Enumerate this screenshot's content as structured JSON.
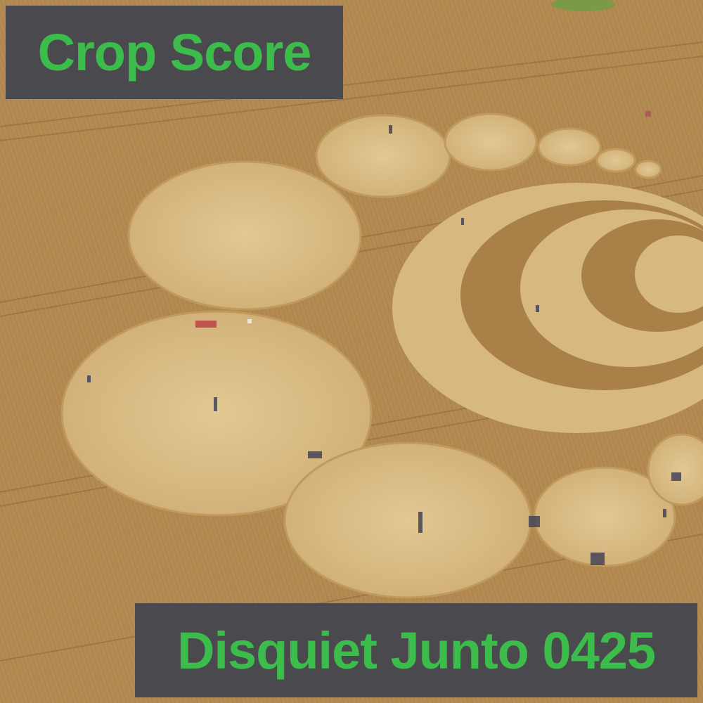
{
  "image": {
    "subject": "aerial-photo-crop-circles",
    "colors": {
      "field": "#b28a52",
      "field_dark": "#9e7640",
      "circle_fill": "#d8bb84",
      "circle_edge": "#c9a86c",
      "label_bg": "#4a4a4e",
      "label_text": "#3cbc4a"
    }
  },
  "overlay": {
    "title": "Crop Score",
    "subtitle": "Disquiet Junto 0425"
  }
}
